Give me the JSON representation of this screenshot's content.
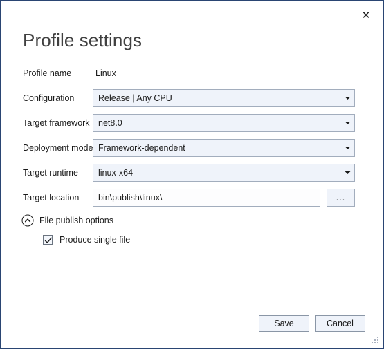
{
  "dialog": {
    "title": "Profile settings",
    "close_icon": "close-icon",
    "border_color": "#2a4573"
  },
  "form": {
    "rows": [
      {
        "label": "Profile name",
        "type": "static",
        "value": "Linux"
      },
      {
        "label": "Configuration",
        "type": "combobox",
        "value": "Release | Any CPU"
      },
      {
        "label": "Target framework",
        "type": "combobox",
        "value": "net8.0"
      },
      {
        "label": "Deployment mode",
        "type": "combobox",
        "value": "Framework-dependent"
      },
      {
        "label": "Target runtime",
        "type": "combobox",
        "value": "linux-x64"
      },
      {
        "label": "Target location",
        "type": "textinput",
        "value": "bin\\publish\\linux\\"
      }
    ],
    "browse_button_label": "...",
    "browse_button_icon": "ellipsis-icon"
  },
  "options_section": {
    "expander_label": "File publish options",
    "expander_icon": "chevron-up-circle-icon",
    "expanded": true,
    "checkboxes": [
      {
        "label": "Produce single file",
        "checked": true
      }
    ]
  },
  "footer": {
    "save_label": "Save",
    "cancel_label": "Cancel"
  },
  "colors": {
    "accent_border": "#2a4573",
    "combo_fill": "#eff3fa",
    "input_fill": "#fdfdfe",
    "field_border": "#a2adbd",
    "text": "#1b1b1b",
    "title_text": "#404040"
  }
}
